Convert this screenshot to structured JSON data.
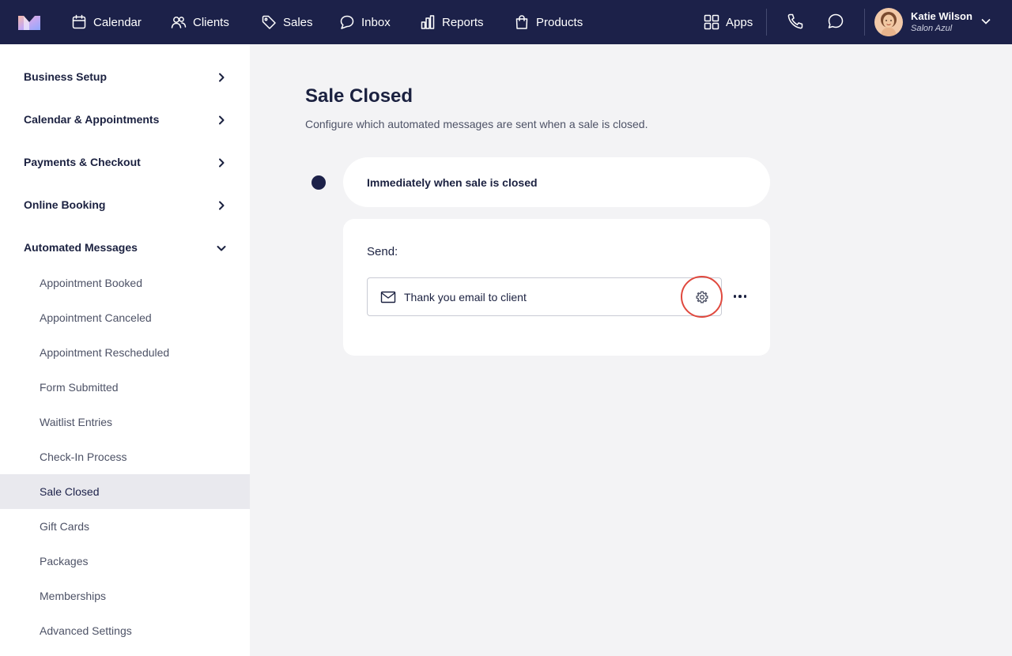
{
  "nav": {
    "items": [
      {
        "label": "Calendar",
        "icon": "calendar-icon"
      },
      {
        "label": "Clients",
        "icon": "clients-icon"
      },
      {
        "label": "Sales",
        "icon": "tag-icon"
      },
      {
        "label": "Inbox",
        "icon": "chat-bubble-icon"
      },
      {
        "label": "Reports",
        "icon": "bar-chart-icon"
      },
      {
        "label": "Products",
        "icon": "shopping-bag-icon"
      }
    ],
    "apps_label": "Apps",
    "user": {
      "name": "Katie Wilson",
      "salon": "Salon Azul"
    }
  },
  "sidebar": {
    "sections": [
      {
        "label": "Business Setup",
        "expanded": false
      },
      {
        "label": "Calendar & Appointments",
        "expanded": false
      },
      {
        "label": "Payments & Checkout",
        "expanded": false
      },
      {
        "label": "Online Booking",
        "expanded": false
      },
      {
        "label": "Automated Messages",
        "expanded": true
      }
    ],
    "sub_items": [
      {
        "label": "Appointment Booked"
      },
      {
        "label": "Appointment Canceled"
      },
      {
        "label": "Appointment Rescheduled"
      },
      {
        "label": "Form Submitted"
      },
      {
        "label": "Waitlist Entries"
      },
      {
        "label": "Check-In Process"
      },
      {
        "label": "Sale Closed",
        "active": true
      },
      {
        "label": "Gift Cards"
      },
      {
        "label": "Packages"
      },
      {
        "label": "Memberships"
      },
      {
        "label": "Advanced Settings"
      }
    ]
  },
  "main": {
    "title": "Sale Closed",
    "description": "Configure which automated messages are sent when a sale is closed.",
    "trigger": {
      "label": "Immediately when sale is closed"
    },
    "card": {
      "send_label": "Send:",
      "message": "Thank you email to client"
    }
  },
  "colors": {
    "nav_bg": "#1c2149",
    "page_bg": "#f3f3f5",
    "active_item_bg": "#e9e9ee",
    "highlight_ring": "#e0493e"
  }
}
